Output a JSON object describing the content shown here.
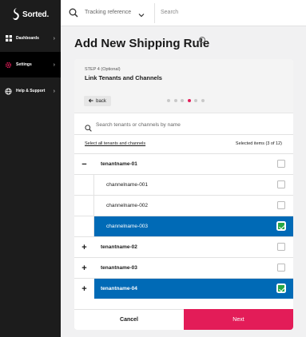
{
  "brand": {
    "name": "Sorted.",
    "accent": "#e31c58",
    "select_blue": "#006ab6",
    "check_green": "#27a845"
  },
  "sidebar": {
    "items": [
      {
        "label": "Dashboards",
        "icon": "dashboard-icon"
      },
      {
        "label": "Settings",
        "icon": "gear-icon",
        "active": true
      },
      {
        "label": "Help & Support",
        "icon": "globe-icon"
      }
    ]
  },
  "topbar": {
    "tracking_label": "Tracking reference",
    "search_placeholder": "Search"
  },
  "page": {
    "title": "Add New Shipping Rule"
  },
  "wizard": {
    "step_label": "STEP 4 (Optional)",
    "step_title": "Link Tenants and Channels",
    "back_label": "back",
    "total_steps": 6,
    "current_step": 4
  },
  "list": {
    "search_placeholder": "Search tenants or channels by name",
    "select_all_label": "Select all tenants and channels",
    "selected_count": "Selected items (3 of 12)",
    "rows": [
      {
        "type": "tenant",
        "label": "tenantname-01",
        "expanded": true,
        "toggle": "−",
        "selected": false
      },
      {
        "type": "channel",
        "label": "channelname-001",
        "selected": false
      },
      {
        "type": "channel",
        "label": "channelname-002",
        "selected": false
      },
      {
        "type": "channel",
        "label": "channelname-003",
        "selected": true
      },
      {
        "type": "tenant",
        "label": "tenantname-02",
        "toggle": "+",
        "selected": false
      },
      {
        "type": "tenant",
        "label": "tenantname-03",
        "toggle": "+",
        "selected": false
      },
      {
        "type": "tenant",
        "label": "tenantname-04",
        "toggle": "+",
        "selected": true
      }
    ]
  },
  "footer": {
    "cancel_label": "Cancel",
    "next_label": "Next"
  }
}
